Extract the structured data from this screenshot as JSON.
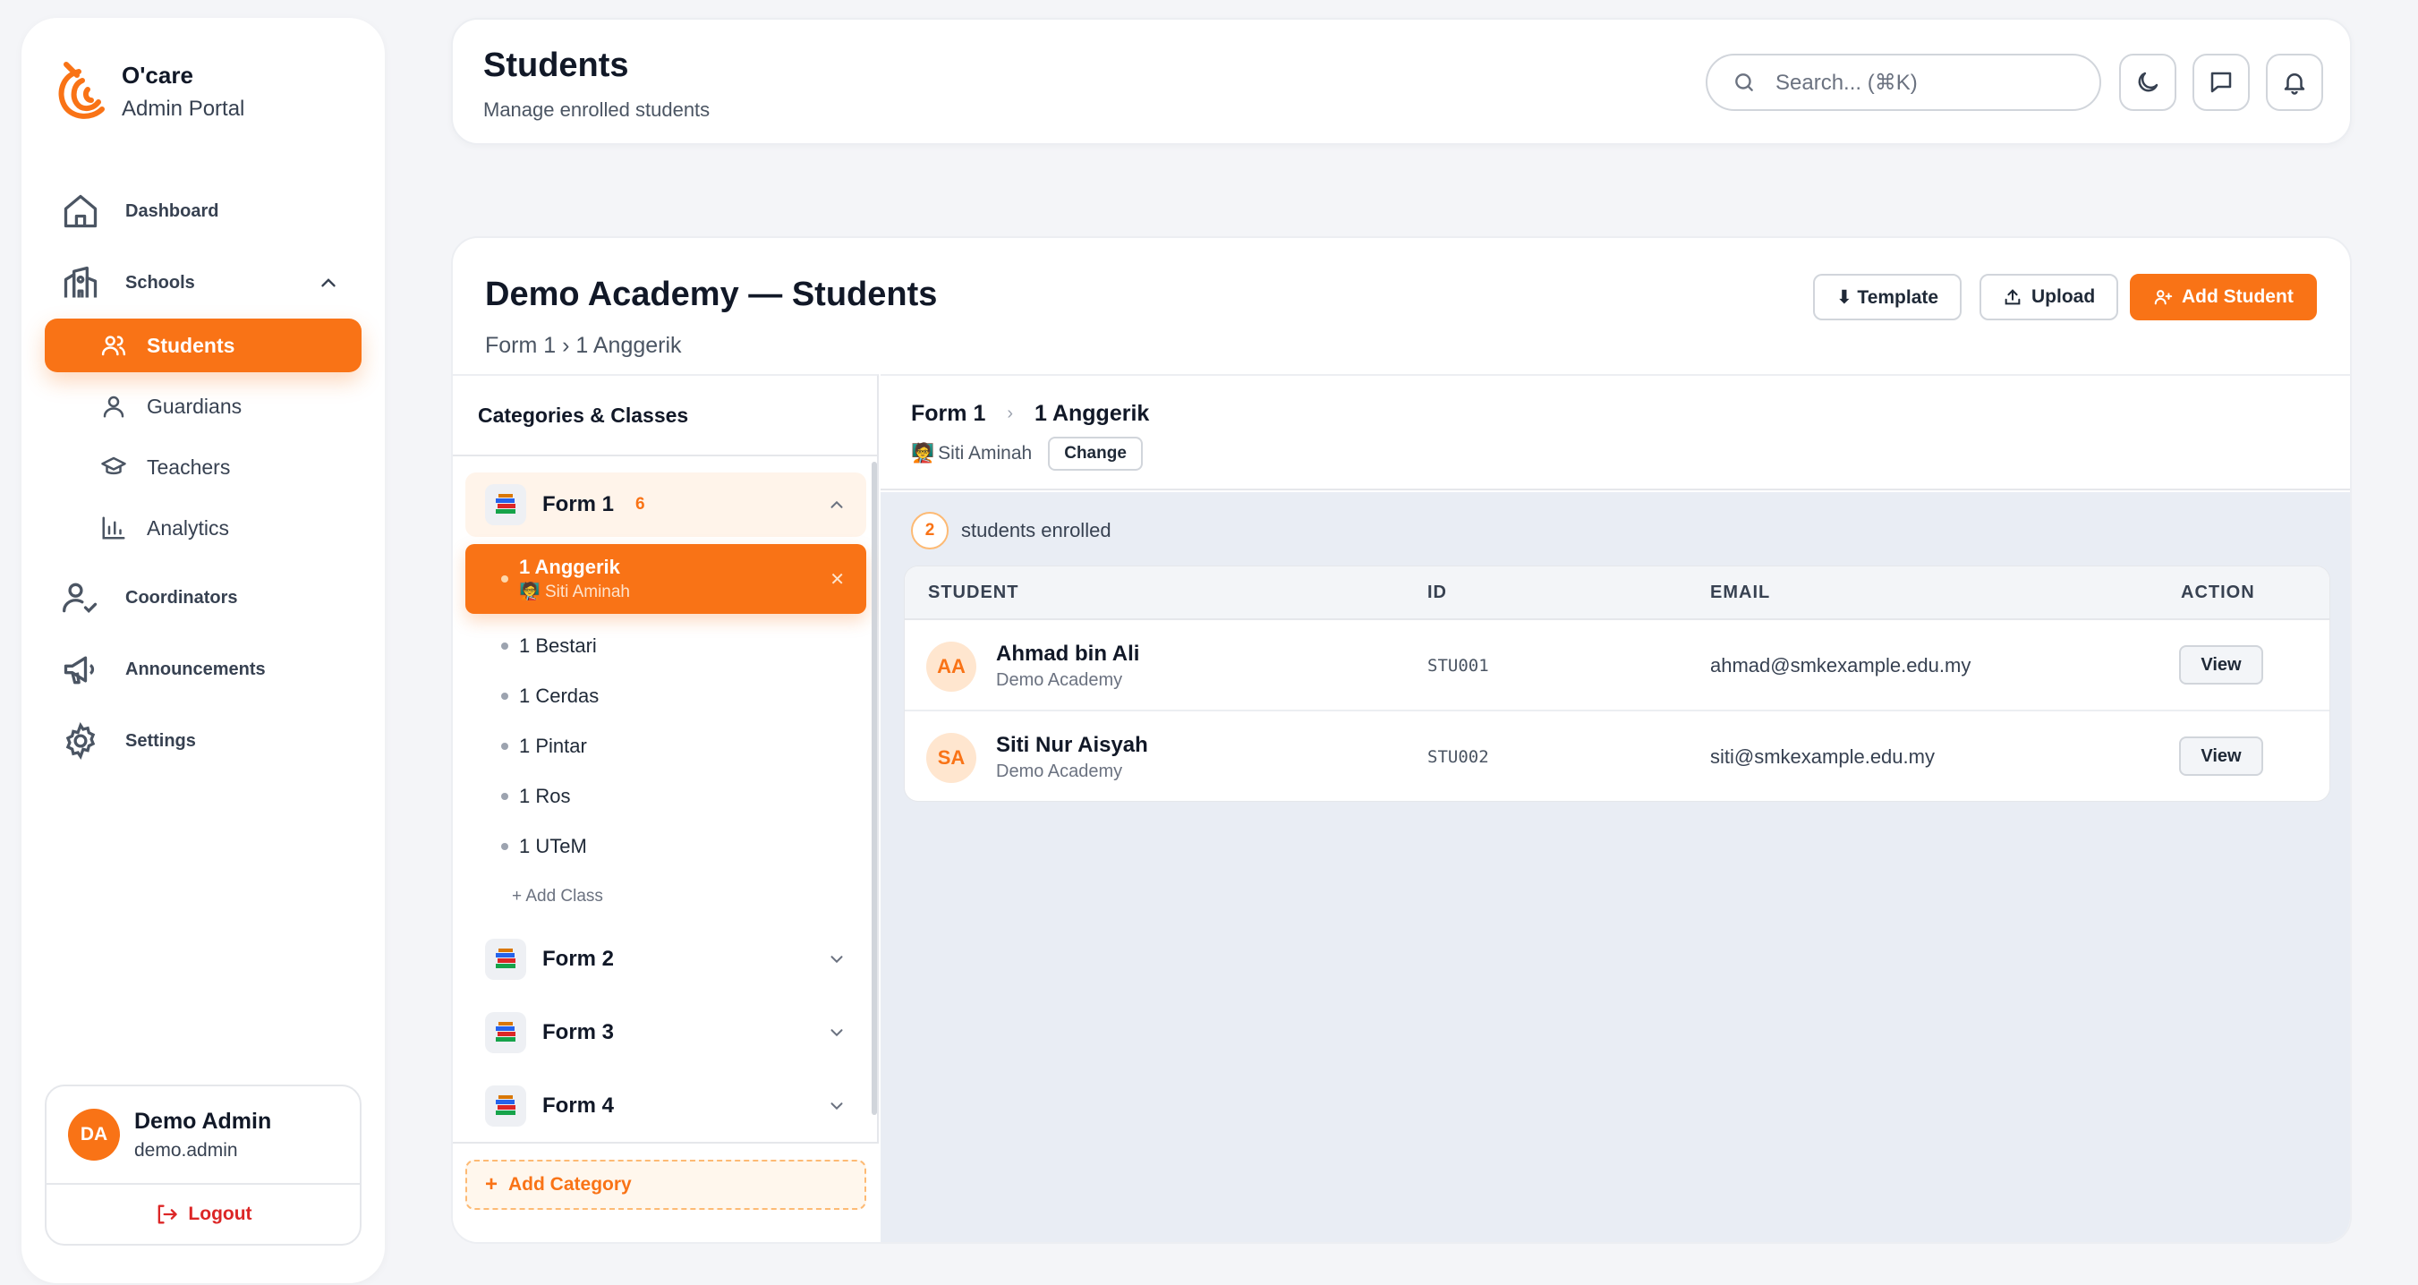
{
  "sidebar": {
    "brand_name": "O'care",
    "brand_sub": "Admin Portal",
    "nav": {
      "dashboard": "Dashboard",
      "schools": "Schools",
      "coordinators": "Coordinators",
      "announcements": "Announcements",
      "settings": "Settings"
    },
    "sub": {
      "students": "Students",
      "guardians": "Guardians",
      "teachers": "Teachers",
      "analytics": "Analytics"
    },
    "user": {
      "initials": "DA",
      "name": "Demo Admin",
      "handle": "demo.admin",
      "logout": "Logout"
    }
  },
  "header": {
    "title": "Students",
    "subtitle": "Manage enrolled students",
    "search_placeholder": "Search... (⌘K)"
  },
  "main": {
    "title": "Demo Academy — Students",
    "breadcrumb": "Form 1 › 1 Anggerik",
    "actions": {
      "template": "⬇ Template",
      "upload": "Upload",
      "add_student": "Add Student"
    }
  },
  "categories": {
    "heading": "Categories & Classes",
    "forms": [
      {
        "label": "Form 1",
        "count": "6",
        "open": true
      },
      {
        "label": "Form 2"
      },
      {
        "label": "Form 3"
      },
      {
        "label": "Form 4"
      }
    ],
    "classes": [
      {
        "name": "1 Anggerik",
        "teacher": "Siti Aminah",
        "active": true
      },
      {
        "name": "1 Bestari"
      },
      {
        "name": "1 Cerdas"
      },
      {
        "name": "1 Pintar"
      },
      {
        "name": "1 Ros"
      },
      {
        "name": "1 UTeM"
      }
    ],
    "add_class": "+ Add Class",
    "add_category": "Add Category"
  },
  "detail": {
    "form": "Form 1",
    "class": "1 Anggerik",
    "teacher": "Siti Aminah",
    "change": "Change",
    "enrolled_count": "2",
    "enrolled_label": "students enrolled",
    "columns": {
      "student": "STUDENT",
      "id": "ID",
      "email": "EMAIL",
      "action": "ACTION"
    },
    "rows": [
      {
        "initials": "AA",
        "name": "Ahmad bin Ali",
        "school": "Demo Academy",
        "id": "STU001",
        "email": "ahmad@smkexample.edu.my",
        "action": "View"
      },
      {
        "initials": "SA",
        "name": "Siti Nur Aisyah",
        "school": "Demo Academy",
        "id": "STU002",
        "email": "siti@smkexample.edu.my",
        "action": "View"
      }
    ]
  },
  "colors": {
    "accent": "#f97316",
    "danger": "#dc2626",
    "panel_bg": "#e9edf4"
  }
}
